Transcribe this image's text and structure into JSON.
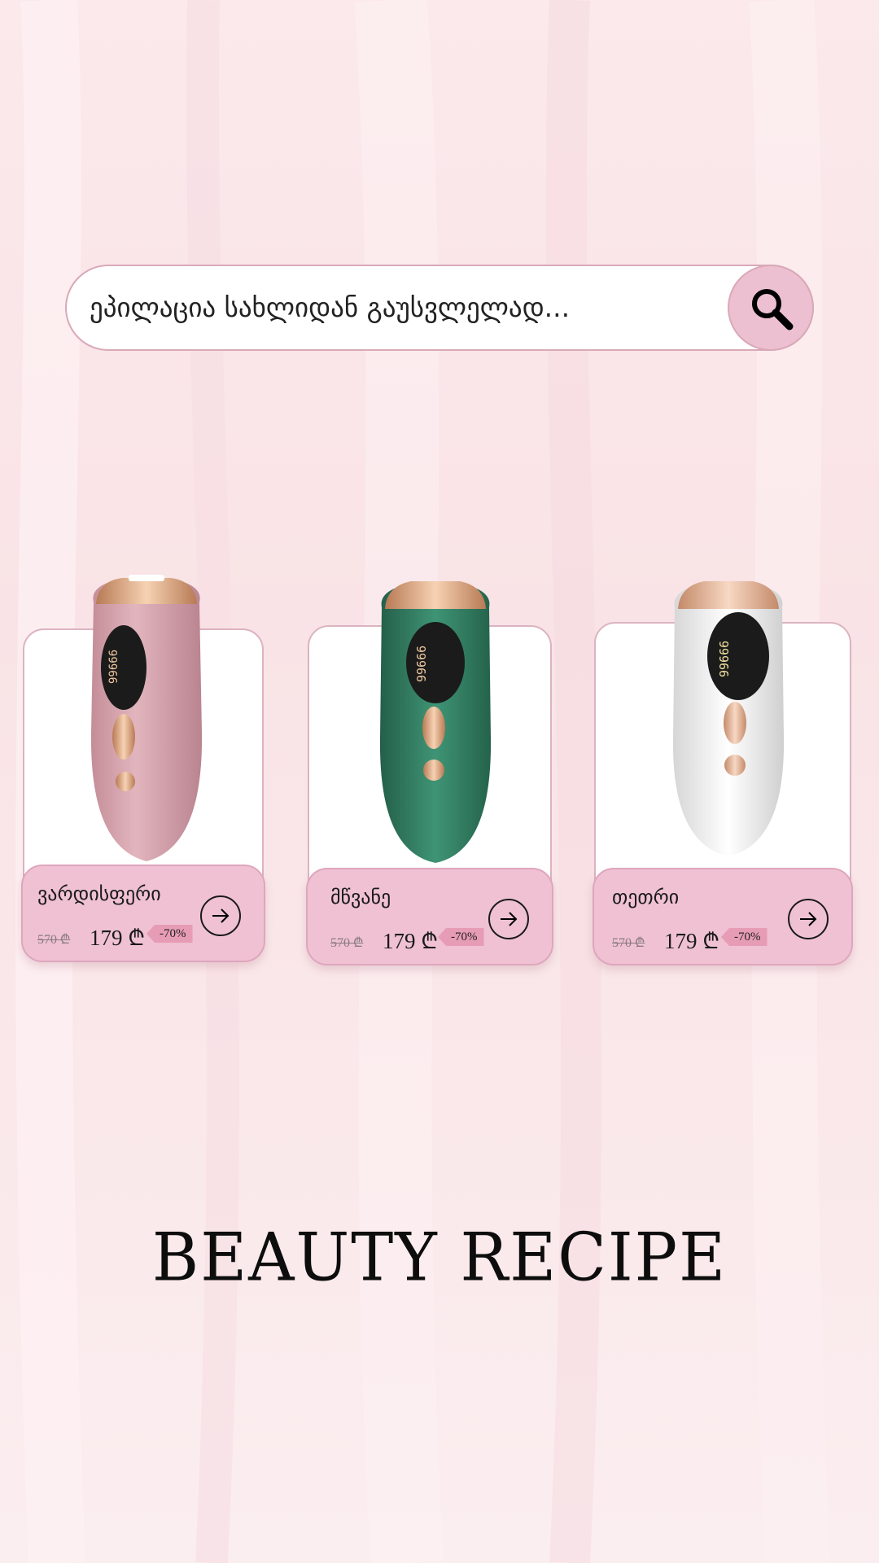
{
  "search": {
    "text": "ეპილაცია სახლიდან გაუსვლელად...",
    "icon": "search-icon"
  },
  "products": [
    {
      "name": "ვარდისფერი",
      "old_price": "570 ₾",
      "price": "179 ₾",
      "discount": "-70%",
      "color": "#d9a7b0"
    },
    {
      "name": "მწვანე",
      "old_price": "570 ₾",
      "price": "179 ₾",
      "discount": "-70%",
      "color": "#2f7a5e"
    },
    {
      "name": "თეთრი",
      "old_price": "570 ₾",
      "price": "179 ₾",
      "discount": "-70%",
      "color": "#f2f2f2"
    }
  ],
  "brand": {
    "title": "BEAUTY RECIPE"
  }
}
